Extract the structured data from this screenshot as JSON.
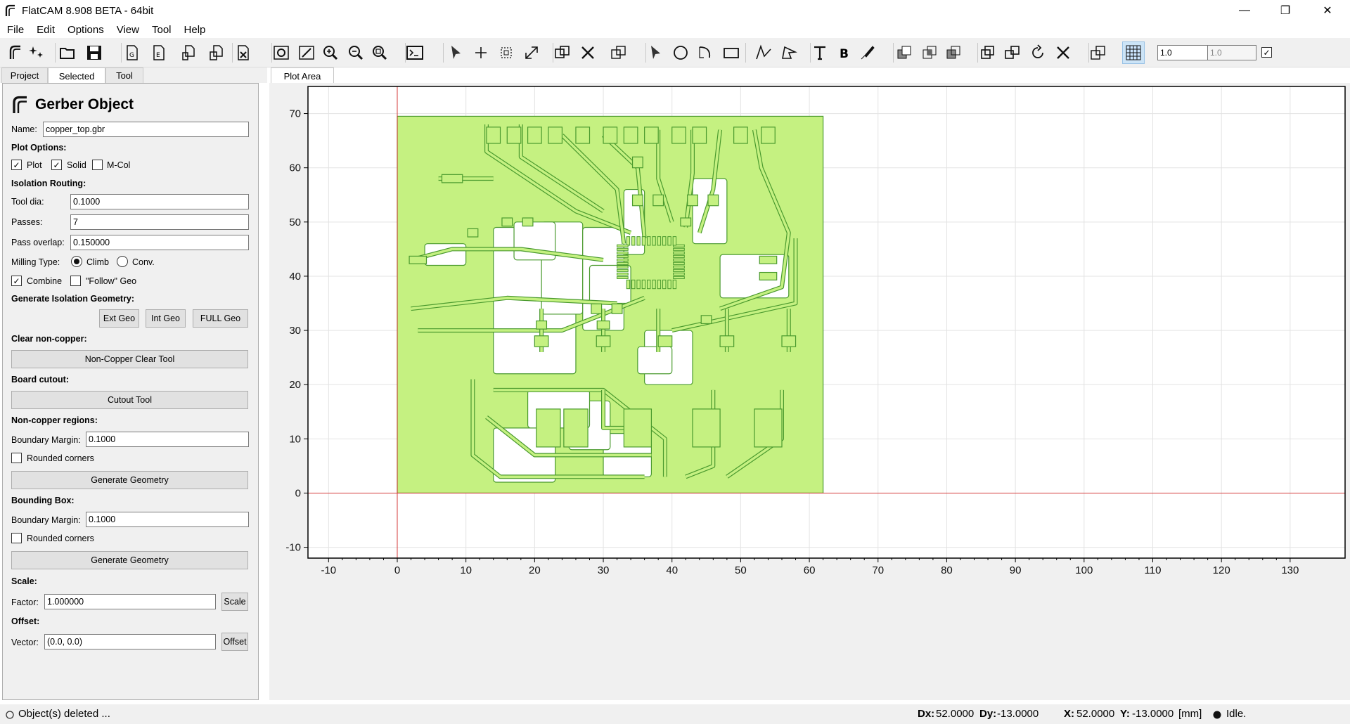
{
  "window": {
    "title": "FlatCAM 8.908 BETA - 64bit",
    "controls": {
      "minimize": "—",
      "maximize": "❐",
      "close": "✕"
    }
  },
  "menu": [
    "File",
    "Edit",
    "Options",
    "View",
    "Tool",
    "Help"
  ],
  "toolbar": {
    "icons": [
      "new-project-icon",
      "workspace-icon",
      "open-icon",
      "save-icon",
      "new-geometry-icon",
      "new-excellon-icon",
      "open-gerber-icon",
      "open-excellon-icon",
      "delete-icon",
      "replot-icon",
      "clear-plot-icon",
      "zoom-in-icon",
      "zoom-out-icon",
      "zoom-fit-icon",
      "shell-icon",
      "select-icon",
      "add-point-icon",
      "copy-icon",
      "move-icon",
      "union-icon",
      "cut-icon",
      "transform-icon",
      "select-tool-icon",
      "circle-icon",
      "arc-icon",
      "rectangle-icon",
      "path-icon",
      "polygon-icon",
      "text-icon",
      "buffer-icon",
      "paint-icon",
      "geo-union-icon",
      "geo-intersection-icon",
      "geo-difference-icon",
      "copy-shape-icon",
      "move-shape-icon",
      "rotate-icon",
      "delete-shape-icon",
      "transform-tool-icon",
      "grid-snap-icon"
    ],
    "grid_x": "1.0",
    "grid_y": "1.0"
  },
  "left_tabs": [
    "Project",
    "Selected",
    "Tool"
  ],
  "object": {
    "header": "Gerber Object",
    "name_label": "Name:",
    "name_value": "copper_top.gbr",
    "plot_options": "Plot Options:",
    "plot": "Plot",
    "solid": "Solid",
    "mcol": "M-Col",
    "isolation": "Isolation Routing:",
    "tool_dia_label": "Tool dia:",
    "tool_dia": "0.1000",
    "passes_label": "Passes:",
    "passes": "7",
    "overlap_label": "Pass overlap:",
    "overlap": "0.150000",
    "milling_label": "Milling Type:",
    "climb": "Climb",
    "conv": "Conv.",
    "combine": "Combine",
    "follow": "\"Follow\" Geo",
    "gen_iso": "Generate Isolation Geometry:",
    "ext_geo": "Ext Geo",
    "int_geo": "Int Geo",
    "full_geo": "FULL Geo",
    "clear_nc": "Clear non-copper:",
    "ncc_tool": "Non-Copper Clear Tool",
    "board_cutout": "Board cutout:",
    "cutout_tool": "Cutout Tool",
    "nc_regions": "Non-copper regions:",
    "boundary_label": "Boundary Margin:",
    "boundary1": "0.1000",
    "rounded": "Rounded corners",
    "gen_geo": "Generate Geometry",
    "bbox": "Bounding Box:",
    "boundary2": "0.1000",
    "scale_hdr": "Scale:",
    "factor_label": "Factor:",
    "factor": "1.000000",
    "scale_btn": "Scale",
    "offset_hdr": "Offset:",
    "vector_label": "Vector:",
    "vector": "(0.0, 0.0)",
    "offset_btn": "Offset"
  },
  "plot_tab": "Plot Area",
  "chart_data": {
    "type": "scatter",
    "x_ticks": [
      -10,
      0,
      10,
      20,
      30,
      40,
      50,
      60,
      70,
      80,
      90,
      100,
      110,
      120,
      130
    ],
    "y_ticks": [
      -10,
      0,
      10,
      20,
      30,
      40,
      50,
      60,
      70
    ],
    "xlim": [
      -13,
      138
    ],
    "ylim": [
      -12,
      75
    ],
    "grid": true,
    "board": {
      "x0": 0,
      "y0": 0,
      "x1": 62,
      "y1": 69.5
    },
    "fill_color": "#c5f181",
    "edge_color": "#4a9a2e"
  },
  "status": {
    "message": "Object(s) deleted ...",
    "dx_label": "Dx:",
    "dx": "52.0000",
    "dy_label": "Dy:",
    "dy": "-13.0000",
    "x_label": "X:",
    "x": "52.0000",
    "y_label": "Y:",
    "y": "-13.0000",
    "units": "[mm]",
    "state": "Idle."
  }
}
